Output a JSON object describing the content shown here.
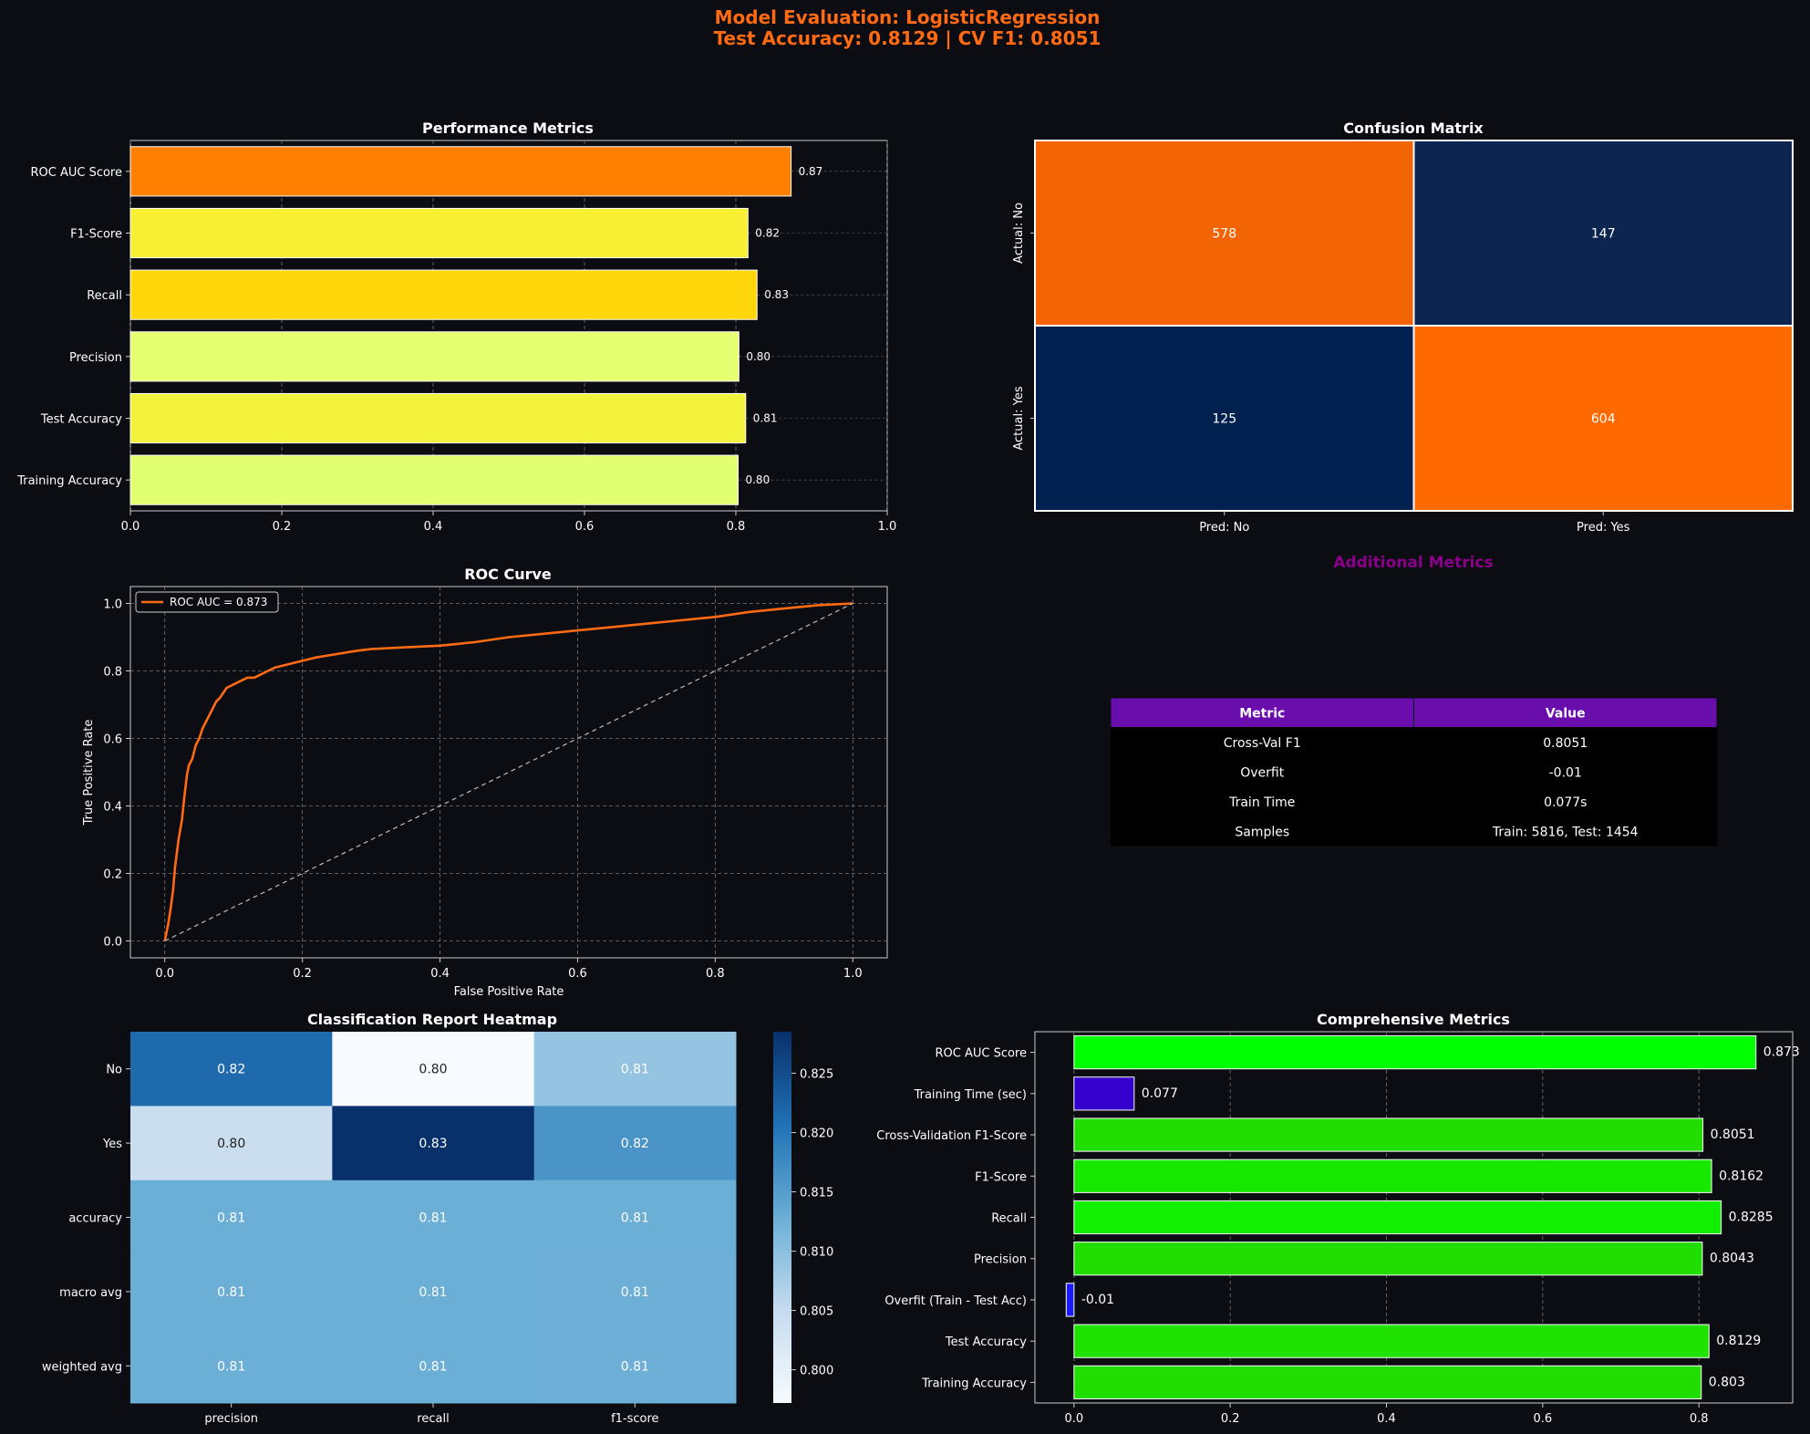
{
  "figure": {
    "title_line1": "Model Evaluation: LogisticRegression",
    "title_line2": "Test Accuracy: 0.8129 | CV F1: 0.8051",
    "title_color": "#ff6a13",
    "background": "#0b0d12"
  },
  "chart_data": [
    {
      "id": "performance",
      "type": "bar",
      "orientation": "horizontal",
      "title": "Performance Metrics",
      "categories": [
        "ROC AUC Score",
        "F1-Score",
        "Recall",
        "Precision",
        "Test Accuracy",
        "Training Accuracy"
      ],
      "values": [
        0.873,
        0.816,
        0.828,
        0.804,
        0.813,
        0.803
      ],
      "value_labels": [
        "0.87",
        "0.82",
        "0.83",
        "0.80",
        "0.81",
        "0.80"
      ],
      "colors": [
        "#ff8000",
        "#f7ef34",
        "#ffd60a",
        "#e6ff70",
        "#f2f13c",
        "#e2ff72"
      ],
      "xlim": [
        0,
        1.0
      ],
      "xticks": [
        "0.0",
        "0.2",
        "0.4",
        "0.6",
        "0.8",
        "1.0"
      ],
      "grid": true
    },
    {
      "id": "confusion",
      "type": "heatmap",
      "title": "Confusion Matrix",
      "rows": [
        "Actual: No",
        "Actual: Yes"
      ],
      "cols": [
        "Pred: No",
        "Pred: Yes"
      ],
      "values": [
        [
          578,
          147
        ],
        [
          125,
          604
        ]
      ],
      "cell_colors": [
        [
          "#f26404",
          "#0c2551"
        ],
        [
          "#00204f",
          "#ff6a00"
        ]
      ]
    },
    {
      "id": "roc",
      "type": "line",
      "title": "ROC Curve",
      "xlabel": "False Positive Rate",
      "ylabel": "True Positive Rate",
      "xlim": [
        -0.05,
        1.05
      ],
      "ylim": [
        -0.05,
        1.05
      ],
      "xticks": [
        "0.0",
        "0.2",
        "0.4",
        "0.6",
        "0.8",
        "1.0"
      ],
      "yticks": [
        "0.0",
        "0.2",
        "0.4",
        "0.6",
        "0.8",
        "1.0"
      ],
      "legend": "top-left",
      "series": [
        {
          "name": "ROC AUC = 0.873",
          "color": "#ff6a13",
          "x": [
            0.0,
            0.005,
            0.008,
            0.012,
            0.015,
            0.02,
            0.025,
            0.028,
            0.032,
            0.035,
            0.04,
            0.045,
            0.05,
            0.055,
            0.06,
            0.065,
            0.07,
            0.075,
            0.08,
            0.09,
            0.1,
            0.11,
            0.12,
            0.13,
            0.14,
            0.15,
            0.16,
            0.18,
            0.2,
            0.22,
            0.25,
            0.28,
            0.3,
            0.35,
            0.4,
            0.45,
            0.5,
            0.55,
            0.6,
            0.65,
            0.7,
            0.75,
            0.8,
            0.85,
            0.9,
            0.95,
            1.0
          ],
          "y": [
            0.0,
            0.05,
            0.09,
            0.15,
            0.22,
            0.3,
            0.36,
            0.42,
            0.49,
            0.52,
            0.54,
            0.58,
            0.6,
            0.63,
            0.65,
            0.67,
            0.69,
            0.71,
            0.72,
            0.75,
            0.76,
            0.77,
            0.78,
            0.78,
            0.79,
            0.8,
            0.81,
            0.82,
            0.83,
            0.84,
            0.85,
            0.86,
            0.865,
            0.87,
            0.875,
            0.885,
            0.9,
            0.91,
            0.92,
            0.93,
            0.94,
            0.95,
            0.96,
            0.975,
            0.985,
            0.995,
            1.0
          ]
        },
        {
          "name": "",
          "color": "#bbbbbb",
          "dashed": true,
          "x": [
            0,
            1
          ],
          "y": [
            0,
            1
          ]
        }
      ],
      "grid": true
    },
    {
      "id": "classification",
      "type": "heatmap",
      "title": "Classification Report Heatmap",
      "rows": [
        "No",
        "Yes",
        "accuracy",
        "macro avg",
        "weighted avg"
      ],
      "cols": [
        "precision",
        "recall",
        "f1-score"
      ],
      "values": [
        [
          0.82,
          0.8,
          0.81
        ],
        [
          0.8,
          0.83,
          0.82
        ],
        [
          0.81,
          0.81,
          0.81
        ],
        [
          0.81,
          0.81,
          0.81
        ],
        [
          0.81,
          0.81,
          0.81
        ]
      ],
      "raw_values": [
        [
          0.8215,
          0.7972,
          0.8092
        ],
        [
          0.8043,
          0.8285,
          0.8162
        ],
        [
          0.8129,
          0.8129,
          0.8129
        ],
        [
          0.8129,
          0.8129,
          0.8127
        ],
        [
          0.8129,
          0.8129,
          0.8127
        ]
      ],
      "colorbar_ticks": [
        "0.800",
        "0.805",
        "0.810",
        "0.815",
        "0.820",
        "0.825"
      ],
      "colorbar_range": [
        0.7972,
        0.8285
      ],
      "colormap": "Blues"
    },
    {
      "id": "comprehensive",
      "type": "bar",
      "orientation": "horizontal",
      "title": "Comprehensive Metrics",
      "categories": [
        "ROC AUC Score",
        "Training Time (sec)",
        "Cross-Validation F1-Score",
        "F1-Score",
        "Recall",
        "Precision",
        "Overfit (Train - Test Acc)",
        "Test Accuracy",
        "Training Accuracy"
      ],
      "values": [
        0.873,
        0.077,
        0.8051,
        0.8162,
        0.8285,
        0.8043,
        -0.01,
        0.8129,
        0.803
      ],
      "value_labels": [
        "0.873",
        "0.077",
        "0.8051",
        "0.8162",
        "0.8285",
        "0.8043",
        "-0.01",
        "0.8129",
        "0.803"
      ],
      "colors": [
        "#00ff00",
        "#3300cc",
        "#22dd00",
        "#18e800",
        "#11f000",
        "#22dd00",
        "#1a1aff",
        "#20e200",
        "#22dd00"
      ],
      "xlim": [
        -0.05,
        0.92
      ],
      "xticks": [
        "0.0",
        "0.2",
        "0.4",
        "0.6",
        "0.8"
      ],
      "grid": true
    }
  ],
  "additional_metrics": {
    "title": "Additional Metrics",
    "title_color": "#8b008b",
    "header_color": "#6a0dad",
    "headers": [
      "Metric",
      "Value"
    ],
    "rows": [
      [
        "Cross-Val F1",
        "0.8051"
      ],
      [
        "Overfit",
        "-0.01"
      ],
      [
        "Train Time",
        "0.077s"
      ],
      [
        "Samples",
        "Train: 5816, Test: 1454"
      ]
    ]
  }
}
